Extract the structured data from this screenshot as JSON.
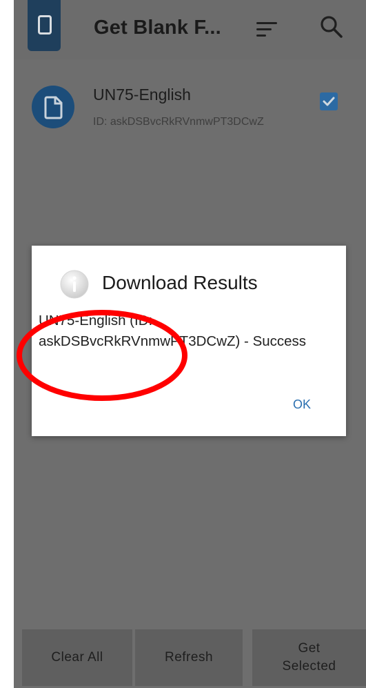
{
  "app_bar": {
    "title": "Get Blank F...",
    "logo_icon": "phone-icon",
    "sort_icon": "sort-icon",
    "search_icon": "search-icon"
  },
  "form_list": [
    {
      "name": "UN75-English",
      "id_text": "ID: askDSBvcRkRVnmwPT3DCwZ",
      "icon": "file-icon",
      "checked": true
    }
  ],
  "dialog": {
    "title": "Download Results",
    "message": "UN75-English (ID: askDSBvcRkRVnmwPT3DCwZ) - Success",
    "ok_label": "OK",
    "icon": "info-icon"
  },
  "bottom_bar": {
    "clear_all": "Clear All",
    "refresh": "Refresh",
    "get_selected": "Get Selected"
  },
  "colors": {
    "accent": "#2a6fb0",
    "overlay_background": "#6e6e6e",
    "annotation": "#ff0000"
  }
}
